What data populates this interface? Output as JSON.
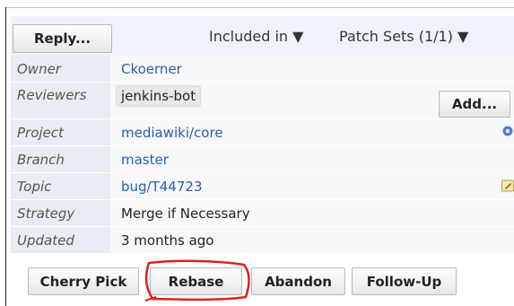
{
  "header": {
    "reply_label": "Reply...",
    "included_in_label": "Included in ▼",
    "patch_sets_label": "Patch Sets (1/1) ▼"
  },
  "info": {
    "owner": {
      "label": "Owner",
      "value": "Ckoerner"
    },
    "reviewers": {
      "label": "Reviewers",
      "value": "jenkins-bot",
      "add_label": "Add..."
    },
    "project": {
      "label": "Project",
      "value": "mediawiki/core"
    },
    "branch": {
      "label": "Branch",
      "value": "master"
    },
    "topic": {
      "label": "Topic",
      "value": "bug/T44723"
    },
    "strategy": {
      "label": "Strategy",
      "value": "Merge if Necessary"
    },
    "updated": {
      "label": "Updated",
      "value": "3 months ago"
    }
  },
  "actions": {
    "cherry_pick": "Cherry Pick",
    "rebase": "Rebase",
    "abandon": "Abandon",
    "follow_up": "Follow-Up"
  },
  "colors": {
    "link": "#2a5db0",
    "label_bg": "#e9edf3",
    "annotation": "#e0201c"
  },
  "icons": [
    "gear-icon",
    "edit-icon",
    "dropdown-arrow"
  ]
}
